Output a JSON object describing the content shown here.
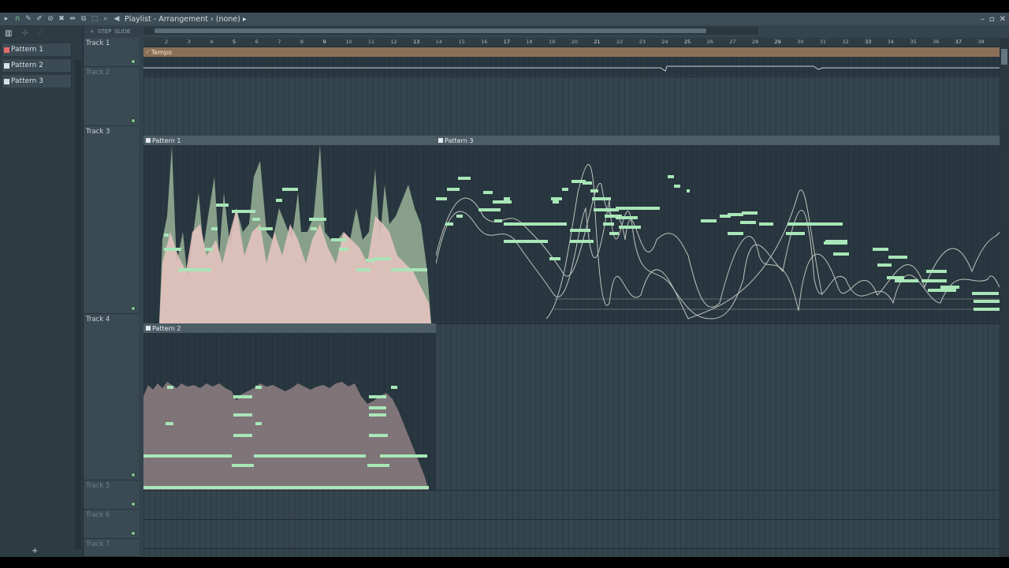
{
  "window": {
    "title": "Playlist - Arrangement",
    "title_sep": "›",
    "selection": "(none)",
    "title_arrow": "▸",
    "controls": [
      "–",
      "▫",
      "✕"
    ]
  },
  "toolbar": {
    "icons": [
      "play-icon",
      "magnet-icon",
      "pencil-icon",
      "brush-icon",
      "delete-icon",
      "mute-icon",
      "slip-icon",
      "slice-icon",
      "select-icon",
      "zoom-icon",
      "speaker-icon"
    ],
    "glyphs": [
      "▸",
      "∩",
      "✎",
      "✐",
      "⊘",
      "✖",
      "⇹",
      "⧉",
      "⬚",
      "⌕",
      "◀"
    ]
  },
  "picker": {
    "header_glyphs": [
      "▥",
      "✣",
      "⟋"
    ],
    "items": [
      {
        "label": "Pattern 1",
        "selected": true
      },
      {
        "label": "Pattern 2",
        "selected": false
      },
      {
        "label": "Pattern 3",
        "selected": false
      }
    ],
    "add": "+"
  },
  "mini_tools": {
    "add": "+",
    "step": "STEP",
    "slide": "SLIDE"
  },
  "ruler": {
    "bars": [
      2,
      3,
      4,
      5,
      6,
      7,
      8,
      9,
      10,
      11,
      12,
      13,
      14,
      15,
      16,
      17,
      18,
      19,
      20,
      21,
      22,
      23,
      24,
      25,
      26,
      27,
      28,
      29,
      30,
      31,
      32,
      33,
      34,
      35,
      36,
      37,
      38
    ],
    "major": [
      5,
      9,
      13,
      17,
      21,
      25,
      29,
      33,
      37
    ]
  },
  "tracks": [
    {
      "name": "Track 1",
      "dim": false
    },
    {
      "name": "Track 2",
      "dim": true
    },
    {
      "name": "Track 3",
      "dim": false
    },
    {
      "name": "Track 4",
      "dim": false
    },
    {
      "name": "Track 5",
      "dim": true
    },
    {
      "name": "Track 6",
      "dim": true
    },
    {
      "name": "Track 7",
      "dim": true
    }
  ],
  "clips": {
    "tempo": {
      "name": "Tempo"
    },
    "pattern1": {
      "name": "Pattern 1"
    },
    "pattern3": {
      "name": "Pattern 3"
    },
    "pattern2": {
      "name": "Pattern 2"
    }
  },
  "colors": {
    "note": "#a9e6b8",
    "accent": "#7fd6a4",
    "wave_pink": "#e4c3be",
    "wave_green": "#a8c4a4"
  }
}
